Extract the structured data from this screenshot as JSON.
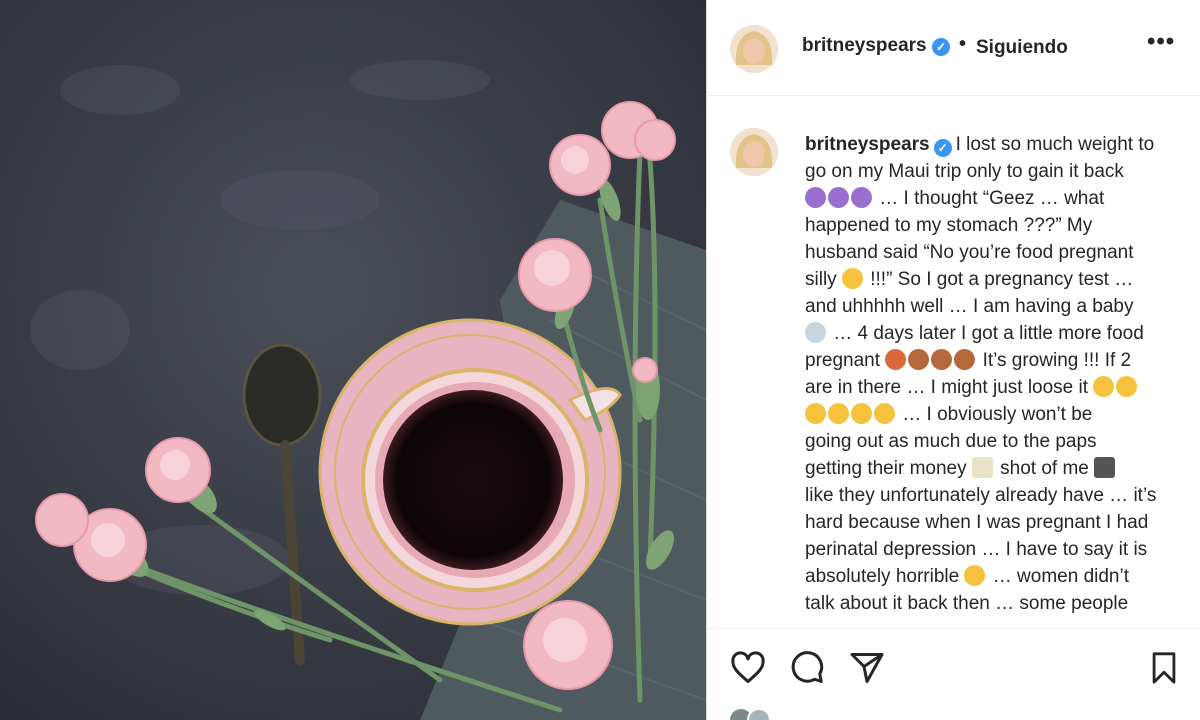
{
  "post": {
    "username": "britneyspears",
    "follow_status": "Siguiendo",
    "separator": "•",
    "more_label": "•••",
    "verified_mark": "✓",
    "caption_lines": [
      "I lost so much weight to",
      "go on my Maui trip only to gain it back",
      "… I thought “Geez … what",
      "happened to my stomach ???” My",
      "husband said “No you’re food pregnant",
      "silly",
      "!!!” So I got a pregnancy test …",
      "and uhhhhh well … I am having a baby",
      "… 4 days later I got a little more food",
      "pregnant",
      "It’s growing !!! If 2",
      "are in there … I might just loose it",
      "… I obviously won’t be",
      "going out as much due to the paps",
      "getting their money",
      "shot of me",
      "like they unfortunately already have … it’s",
      "hard because when I was pregnant I had",
      "perinatal depression … I have to say it is",
      "absolutely horrible",
      "… women didn’t",
      "talk about it back then … some people"
    ]
  },
  "colors": {
    "verified": "#3897f0",
    "text": "#262626",
    "photo_bg": "#3a3d46",
    "cup_pink": "#e8a9b8"
  },
  "icons": {
    "like": "heart-icon",
    "comment": "comment-icon",
    "share": "paper-plane-icon",
    "save": "bookmark-icon",
    "options": "more-options-icon"
  }
}
